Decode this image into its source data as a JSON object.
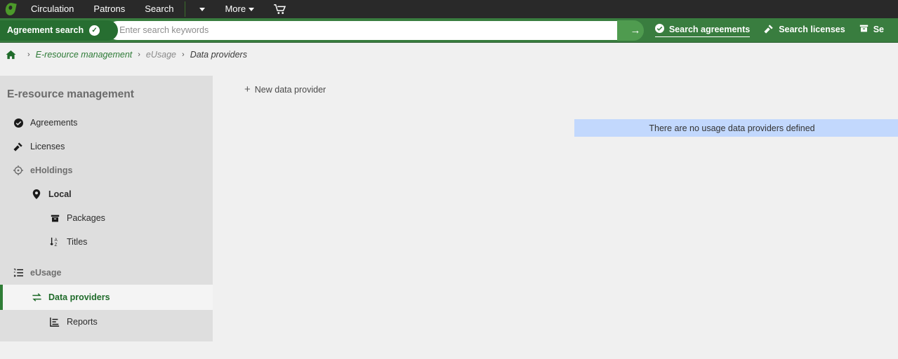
{
  "topnav": {
    "logo_icon": "koha-leaf-logo",
    "items": [
      {
        "label": "Circulation",
        "icon": null
      },
      {
        "label": "Patrons",
        "icon": null
      },
      {
        "label": "Search",
        "icon": null
      }
    ],
    "divider": true,
    "dropdown_caret_icon": "chevron-down-icon",
    "more_label": "More",
    "cart_icon": "shopping-cart-icon"
  },
  "search": {
    "pill_label": "Agreement search",
    "pill_icon": "check-circle-icon",
    "placeholder": "Enter search keywords",
    "value": "",
    "submit_icon": "arrow-right-icon",
    "options": [
      {
        "label": "Search agreements",
        "icon": "check-circle-icon",
        "active": true
      },
      {
        "label": "Search licenses",
        "icon": "gavel-icon",
        "active": false
      },
      {
        "label": "Se",
        "icon": "package-icon",
        "active": false
      }
    ]
  },
  "breadcrumb": {
    "home_icon": "home-icon",
    "separator": "›",
    "items": [
      {
        "label": "E-resource management",
        "style": "link"
      },
      {
        "label": "eUsage",
        "style": "muted"
      },
      {
        "label": "Data providers",
        "style": "current"
      }
    ]
  },
  "sidebar": {
    "title": "E-resource management",
    "items": [
      {
        "label": "Agreements",
        "icon": "check-circle-icon",
        "level": 1,
        "active": false
      },
      {
        "label": "Licenses",
        "icon": "gavel-icon",
        "level": 1,
        "active": false
      },
      {
        "label": "eHoldings",
        "icon": "crosshair-icon",
        "level": 1,
        "active": false,
        "muted": true
      },
      {
        "label": "Local",
        "icon": "map-pin-icon",
        "level": 2,
        "active": false
      },
      {
        "label": "Packages",
        "icon": "package-icon",
        "level": 3,
        "active": false
      },
      {
        "label": "Titles",
        "icon": "sort-alpha-icon",
        "level": 3,
        "active": false
      },
      {
        "label": "eUsage",
        "icon": "list-ordered-icon",
        "level": 1,
        "active": false,
        "muted": true
      },
      {
        "label": "Data providers",
        "icon": "exchange-icon",
        "level": 3,
        "active": true
      },
      {
        "label": "Reports",
        "icon": "bar-chart-icon",
        "level": 3,
        "active": false
      }
    ]
  },
  "main": {
    "new_provider_label": "New data provider",
    "new_provider_icon": "plus-icon",
    "banner_text": "There are no usage data providers defined"
  },
  "colors": {
    "topnav_bg": "#292929",
    "searchbar_bg": "#397d3f",
    "pill_bg": "#276e31",
    "go_btn_bg": "#4f9b4f",
    "sidebar_bg": "#dedede",
    "active_accent": "#2f7d36",
    "banner_bg": "#c2d8fd",
    "page_bg": "#f0f0f0"
  }
}
